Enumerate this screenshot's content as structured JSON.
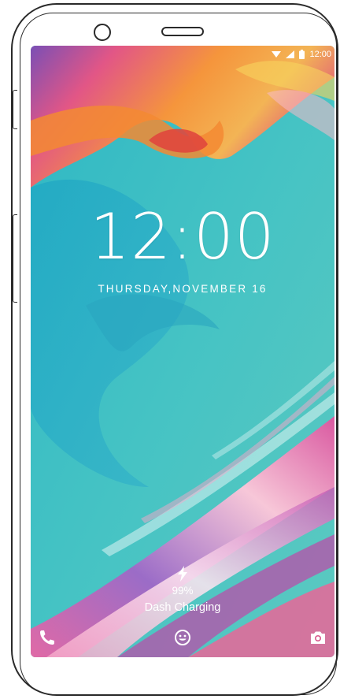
{
  "status_bar": {
    "time": "12:00",
    "icons": [
      "wifi-icon",
      "signal-icon",
      "battery-icon"
    ]
  },
  "lock_screen": {
    "clock": "12:00",
    "date": "THURSDAY,NOVEMBER 16",
    "charging": {
      "icon": "lightning-icon",
      "percent": "99%",
      "label": "Dash Charging"
    }
  },
  "shortcuts": {
    "left": "phone-icon",
    "center": "smiley-icon",
    "right": "camera-icon"
  },
  "colors": {
    "teal": "#3cbfc2",
    "orange": "#f08a3a",
    "pink": "#e65a8a",
    "purple": "#7a5ab8"
  }
}
